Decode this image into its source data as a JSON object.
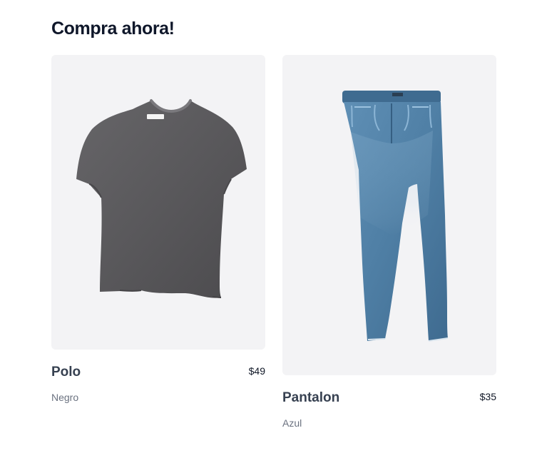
{
  "page": {
    "title": "Compra ahora!"
  },
  "products": [
    {
      "name": "Polo",
      "price": "$49",
      "color": "Negro",
      "image_icon": "tshirt-icon",
      "swatch": "#58585a"
    },
    {
      "name": "Pantalon",
      "price": "$35",
      "color": "Azul",
      "image_icon": "jeans-icon",
      "swatch": "#4f7fa5"
    }
  ],
  "colors": {
    "title": "#0f172a",
    "name": "#374151",
    "price": "#111827",
    "subtle": "#6b7280",
    "image_background": "#f3f3f5"
  }
}
